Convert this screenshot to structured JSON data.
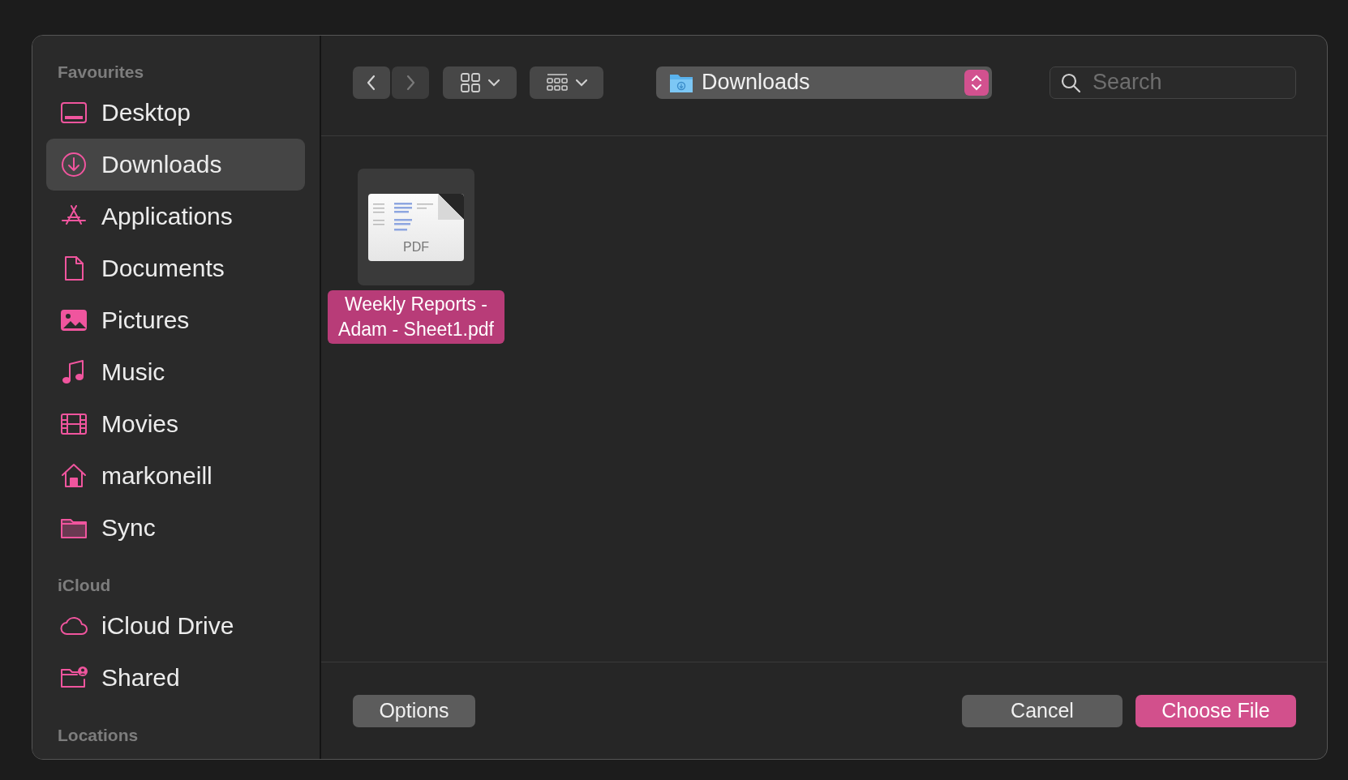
{
  "sidebar": {
    "sections": [
      {
        "title": "Favourites",
        "items": [
          {
            "label": "Desktop",
            "selected": false
          },
          {
            "label": "Downloads",
            "selected": true
          },
          {
            "label": "Applications",
            "selected": false
          },
          {
            "label": "Documents",
            "selected": false
          },
          {
            "label": "Pictures",
            "selected": false
          },
          {
            "label": "Music",
            "selected": false
          },
          {
            "label": "Movies",
            "selected": false
          },
          {
            "label": "markoneill",
            "selected": false
          },
          {
            "label": "Sync",
            "selected": false
          }
        ]
      },
      {
        "title": "iCloud",
        "items": [
          {
            "label": "iCloud Drive",
            "selected": false
          },
          {
            "label": "Shared",
            "selected": false
          }
        ]
      },
      {
        "title": "Locations"
      }
    ]
  },
  "toolbar": {
    "back": {
      "disabled": false
    },
    "forward": {
      "disabled": true
    },
    "location": "Downloads",
    "search": {
      "placeholder": "Search"
    }
  },
  "files": [
    {
      "name": "Weekly Reports - Adam - Sheet1.pdf",
      "type_label": "PDF",
      "selected": true
    }
  ],
  "buttons": [
    {
      "label": "Options",
      "kind": "plain",
      "default": false
    },
    {
      "label": "Cancel",
      "kind": "plain",
      "default": false
    },
    {
      "label": "Choose File",
      "kind": "plain",
      "default": true
    }
  ]
}
